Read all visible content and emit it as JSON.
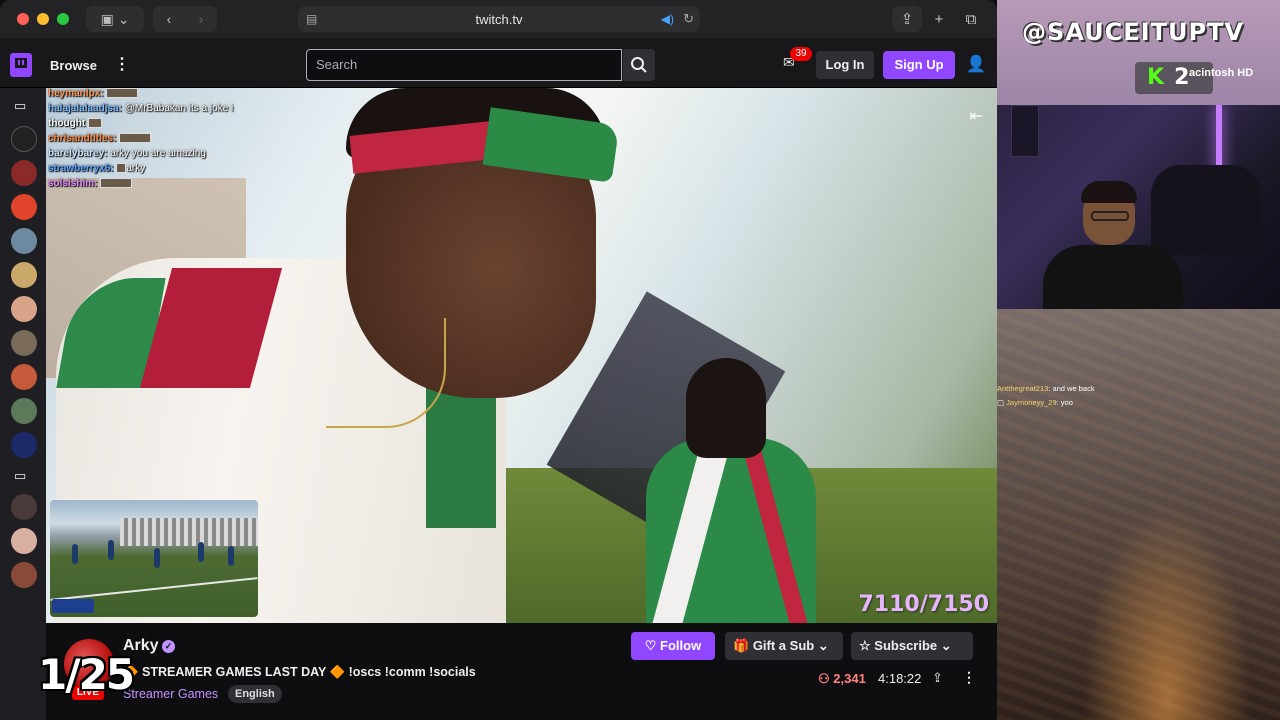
{
  "browser": {
    "url": "twitch.tv"
  },
  "topnav": {
    "browse_label": "Browse",
    "search_placeholder": "Search",
    "inbox_count": "39",
    "login_label": "Log In",
    "signup_label": "Sign Up"
  },
  "player_chat": [
    {
      "user": "heymanlpx:",
      "message": "",
      "color": "#ff9a5c"
    },
    {
      "user": "halajalalaadjsa:",
      "message": "@MrBabakan its a joke i",
      "color": "#7bb8ff"
    },
    {
      "user": "",
      "message": "thought",
      "color": "#ffffff"
    },
    {
      "user": "chrisandtitles:",
      "message": "",
      "color": "#ff8c42"
    },
    {
      "user": "barelybarey:",
      "message": "arky you are amazing",
      "color": "#cfe7ff"
    },
    {
      "user": "strawberryx6:",
      "message": "arky",
      "color": "#5aa0ff"
    },
    {
      "user": "solsishim:",
      "message": "",
      "color": "#e48cff"
    }
  ],
  "player": {
    "viewer_goal": "7110/7150"
  },
  "channel": {
    "name": "Arky",
    "title": "🔶 STREAMER GAMES LAST DAY 🔶 !oscs !comm !socials",
    "category": "Streamer Games",
    "language": "English",
    "live_label": "LIVE",
    "follow_label": "Follow",
    "gift_label": "Gift a Sub",
    "subscribe_label": "Subscribe",
    "viewers": "2,341",
    "uptime": "4:18:22"
  },
  "overlay": {
    "brand": "@SAUCEITUPTV",
    "kick_letter": "K",
    "kick_number": "2",
    "disk_label": "acintosh HD",
    "counter": "1/25"
  },
  "side_chat": [
    {
      "user": "Antthegreat213",
      "message": ": and we back"
    },
    {
      "user": "Jaymoneyy_29",
      "message": ": yoo"
    }
  ]
}
